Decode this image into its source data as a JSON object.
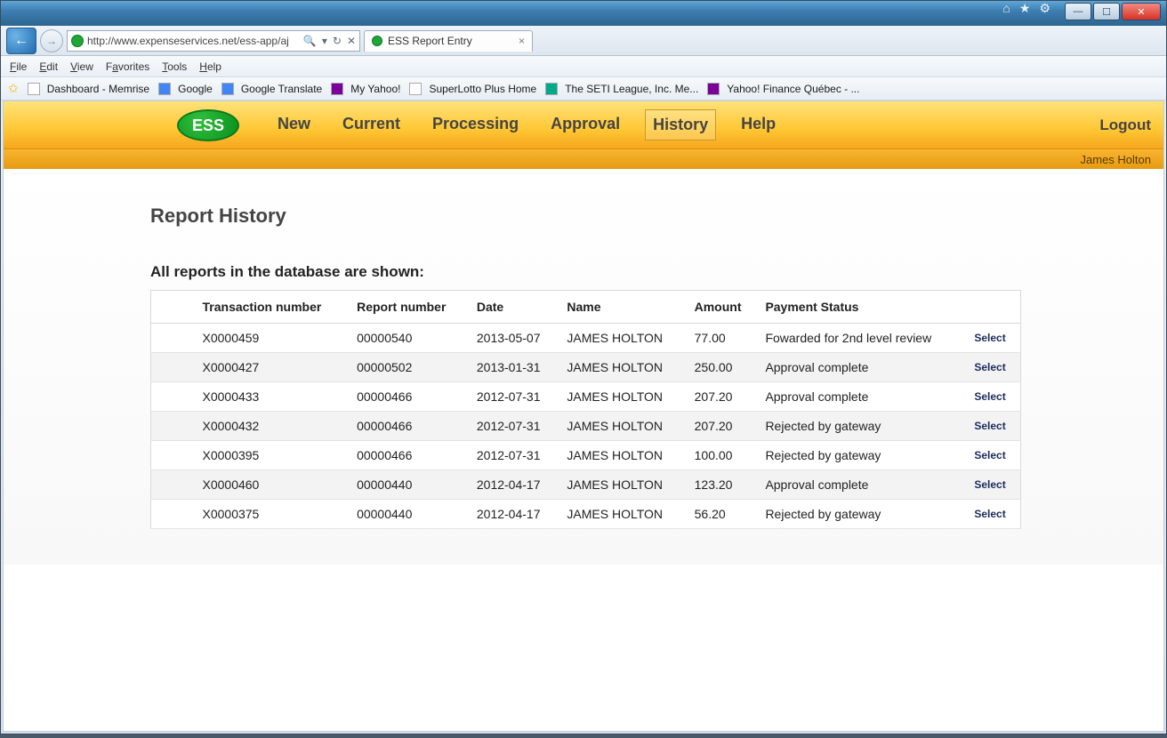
{
  "browser": {
    "url": "http://www.expenseservices.net/ess-app/aj",
    "tab_title": "ESS Report Entry",
    "menu": [
      "File",
      "Edit",
      "View",
      "Favorites",
      "Tools",
      "Help"
    ],
    "favorites": [
      "Dashboard - Memrise",
      "Google",
      "Google Translate",
      "My Yahoo!",
      "SuperLotto Plus Home",
      "The SETI League, Inc. Me...",
      "Yahoo! Finance Québec - ..."
    ]
  },
  "app": {
    "logo": "ESS",
    "nav": [
      "New",
      "Current",
      "Processing",
      "Approval",
      "History",
      "Help"
    ],
    "nav_active": "History",
    "logout": "Logout",
    "user": "James Holton"
  },
  "page": {
    "title": "Report History",
    "subtitle": "All reports in the database are shown:",
    "headers": [
      "",
      "Transaction number",
      "Report number",
      "Date",
      "Name",
      "Amount",
      "Payment Status",
      ""
    ],
    "select_label": "Select",
    "rows": [
      {
        "txn": "X0000459",
        "rpt": "00000540",
        "date": "2013-05-07",
        "name": "JAMES HOLTON",
        "amount": "77.00",
        "status": "Fowarded for 2nd level review"
      },
      {
        "txn": "X0000427",
        "rpt": "00000502",
        "date": "2013-01-31",
        "name": "JAMES HOLTON",
        "amount": "250.00",
        "status": "Approval complete"
      },
      {
        "txn": "X0000433",
        "rpt": "00000466",
        "date": "2012-07-31",
        "name": "JAMES HOLTON",
        "amount": "207.20",
        "status": "Approval complete"
      },
      {
        "txn": "X0000432",
        "rpt": "00000466",
        "date": "2012-07-31",
        "name": "JAMES HOLTON",
        "amount": "207.20",
        "status": "Rejected by gateway"
      },
      {
        "txn": "X0000395",
        "rpt": "00000466",
        "date": "2012-07-31",
        "name": "JAMES HOLTON",
        "amount": "100.00",
        "status": "Rejected by gateway"
      },
      {
        "txn": "X0000460",
        "rpt": "00000440",
        "date": "2012-04-17",
        "name": "JAMES HOLTON",
        "amount": "123.20",
        "status": "Approval complete"
      },
      {
        "txn": "X0000375",
        "rpt": "00000440",
        "date": "2012-04-17",
        "name": "JAMES HOLTON",
        "amount": "56.20",
        "status": "Rejected by gateway"
      }
    ]
  }
}
